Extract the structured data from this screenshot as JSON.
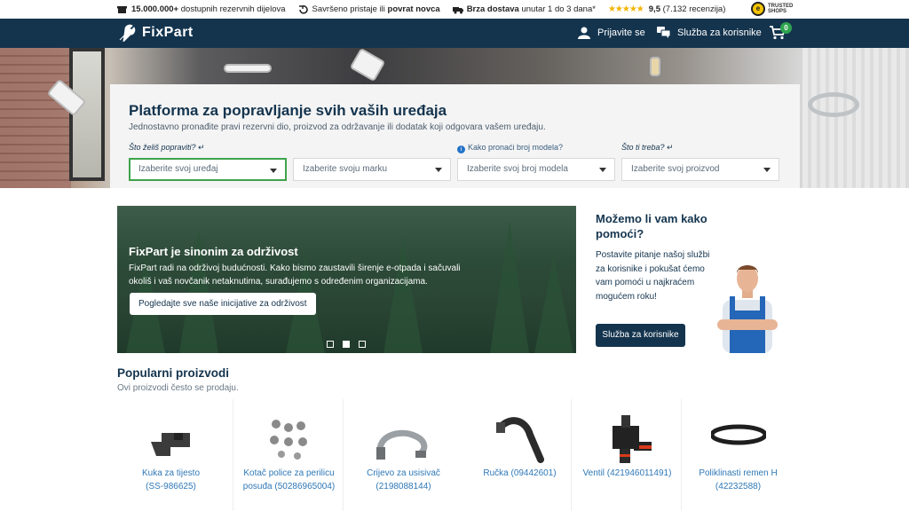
{
  "topbar": {
    "parts_count": "15.000.000+",
    "parts_text": "dostupnih rezervnih dijelova",
    "fit_text": "Savršeno pristaje ili",
    "fit_bold": "povrat novca",
    "delivery_bold": "Brza dostava",
    "delivery_text": "unutar 1 do 3 dana*",
    "stars": "★★★★★",
    "rating": "9,5",
    "reviews": "(7.132 recenzija)",
    "trusted_line1": "TRUSTED",
    "trusted_line2": "SHOPS"
  },
  "nav": {
    "brand": "FixPart",
    "login": "Prijavite se",
    "service": "Služba za korisnike",
    "cart_count": "0"
  },
  "search": {
    "title": "Platforma za popravljanje svih vaših uređaja",
    "subtitle": "Jednostavno pronađite pravi rezervni dio, proizvod za održavanje ili dodatak koji odgovara vašem uređaju.",
    "label_repair": "Što želiš popraviti?",
    "label_model_help": "Kako pronaći broj modela?",
    "label_need": "Što ti treba?",
    "select_device": "Izaberite svoj uređaj",
    "select_brand": "Izaberite svoju marku",
    "select_model": "Izaberite svoj broj modela",
    "select_product": "Izaberite svoj proizvod"
  },
  "banner": {
    "title": "FixPart je sinonim za održivost",
    "text": "FixPart radi na održivoj budućnosti. Kako bismo zaustavili širenje e-otpada i sačuvali okoliš i vaš novčanik netaknutima, surađujemo s određenim organizacijama.",
    "button": "Pogledajte sve naše inicijative za održivost",
    "slides": 3,
    "active_slide": 2
  },
  "help": {
    "title": "Možemo li vam kako pomoći?",
    "text": "Postavite pitanje našoj službi za korisnike i pokušat ćemo vam pomoći u najkraćem mogućem roku!",
    "button": "Služba za korisnike"
  },
  "popular": {
    "title": "Popularni proizvodi",
    "subtitle": "Ovi proizvodi često se prodaju.",
    "items": [
      {
        "name": "Kuka za tijesto",
        "code": "(SS-986625)",
        "icon": "dough-hook-icon"
      },
      {
        "name": "Kotač police za perilicu",
        "code": "posuđa (50286965004)",
        "icon": "dishwasher-wheel-icon"
      },
      {
        "name": "Crijevo za usisivač",
        "code": "(2198088144)",
        "icon": "vacuum-hose-icon"
      },
      {
        "name": "Ručka (09442601)",
        "code": "",
        "icon": "handle-icon"
      },
      {
        "name": "Ventil (421946011491)",
        "code": "",
        "icon": "valve-icon"
      },
      {
        "name": "Poliklinasti remen H",
        "code": "(42232588)",
        "icon": "belt-icon"
      }
    ]
  },
  "colors": {
    "navy": "#14344e",
    "green": "#3ea34b",
    "link": "#2f78b7",
    "star": "#f4b400"
  }
}
